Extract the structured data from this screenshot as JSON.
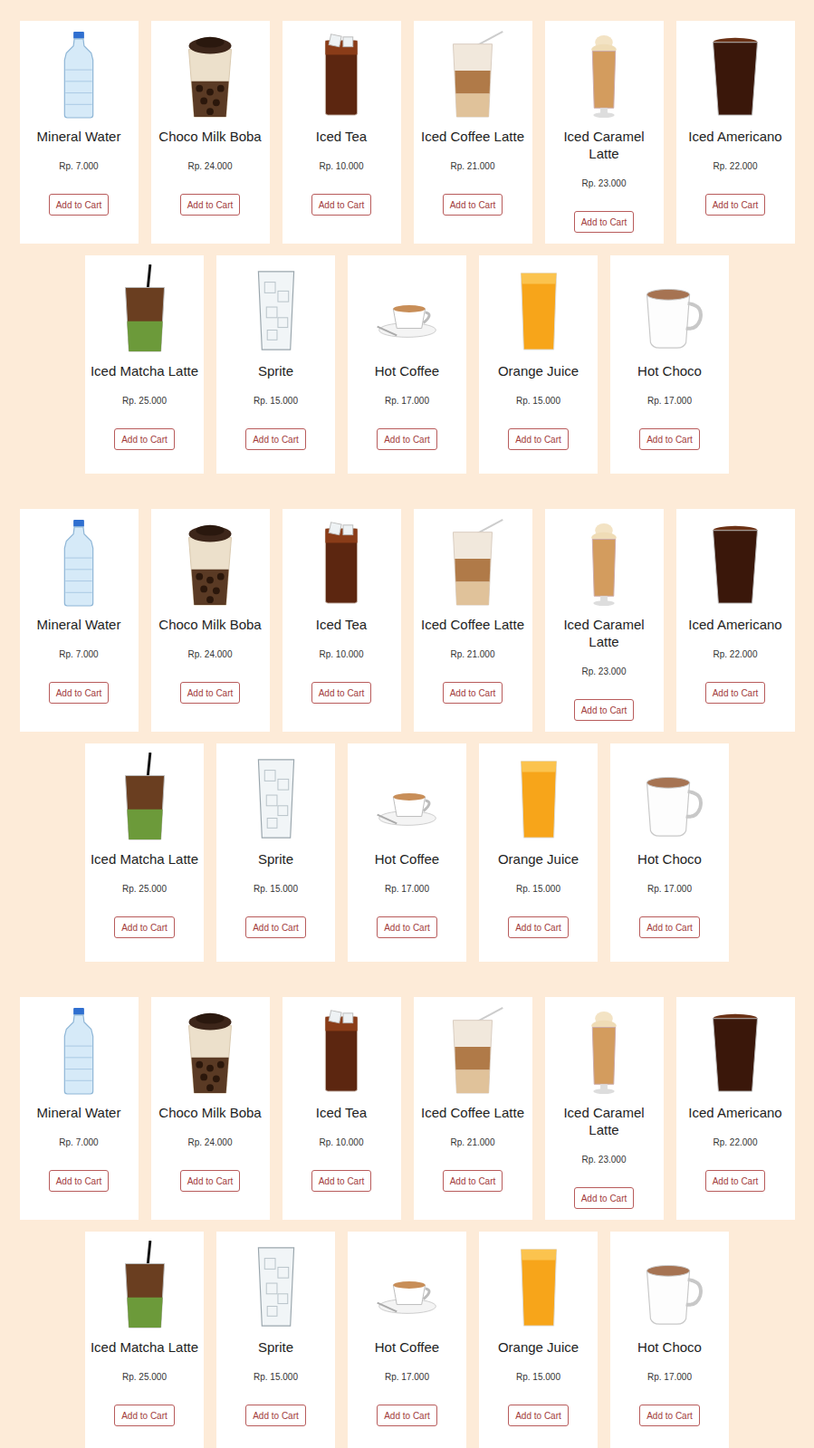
{
  "sections": [
    {
      "items": [
        {
          "name": "Mineral Water",
          "price": "Rp. 7.000",
          "button": "Add to Cart",
          "kind": "bottle"
        },
        {
          "name": "Choco Milk Boba",
          "price": "Rp. 24.000",
          "button": "Add to Cart",
          "kind": "boba"
        },
        {
          "name": "Iced Tea",
          "price": "Rp. 10.000",
          "button": "Add to Cart",
          "kind": "tea"
        },
        {
          "name": "Iced Coffee Latte",
          "price": "Rp. 21.000",
          "button": "Add to Cart",
          "kind": "latte"
        },
        {
          "name": "Iced Caramel Latte",
          "price": "Rp. 23.000",
          "button": "Add to Cart",
          "kind": "caramel"
        },
        {
          "name": "Iced Americano",
          "price": "Rp. 22.000",
          "button": "Add to Cart",
          "kind": "americano"
        },
        {
          "name": "Iced Matcha Latte",
          "price": "Rp. 25.000",
          "button": "Add to Cart",
          "kind": "matcha"
        },
        {
          "name": "Sprite",
          "price": "Rp. 15.000",
          "button": "Add to Cart",
          "kind": "sprite"
        },
        {
          "name": "Hot Coffee",
          "price": "Rp. 17.000",
          "button": "Add to Cart",
          "kind": "coffee"
        },
        {
          "name": "Orange Juice",
          "price": "Rp. 15.000",
          "button": "Add to Cart",
          "kind": "juice"
        },
        {
          "name": "Hot Choco",
          "price": "Rp. 17.000",
          "button": "Add to Cart",
          "kind": "choco"
        }
      ]
    },
    {
      "items": [
        {
          "name": "Mineral Water",
          "price": "Rp. 7.000",
          "button": "Add to Cart",
          "kind": "bottle"
        },
        {
          "name": "Choco Milk Boba",
          "price": "Rp. 24.000",
          "button": "Add to Cart",
          "kind": "boba"
        },
        {
          "name": "Iced Tea",
          "price": "Rp. 10.000",
          "button": "Add to Cart",
          "kind": "tea"
        },
        {
          "name": "Iced Coffee Latte",
          "price": "Rp. 21.000",
          "button": "Add to Cart",
          "kind": "latte"
        },
        {
          "name": "Iced Caramel Latte",
          "price": "Rp. 23.000",
          "button": "Add to Cart",
          "kind": "caramel"
        },
        {
          "name": "Iced Americano",
          "price": "Rp. 22.000",
          "button": "Add to Cart",
          "kind": "americano"
        },
        {
          "name": "Iced Matcha Latte",
          "price": "Rp. 25.000",
          "button": "Add to Cart",
          "kind": "matcha"
        },
        {
          "name": "Sprite",
          "price": "Rp. 15.000",
          "button": "Add to Cart",
          "kind": "sprite"
        },
        {
          "name": "Hot Coffee",
          "price": "Rp. 17.000",
          "button": "Add to Cart",
          "kind": "coffee"
        },
        {
          "name": "Orange Juice",
          "price": "Rp. 15.000",
          "button": "Add to Cart",
          "kind": "juice"
        },
        {
          "name": "Hot Choco",
          "price": "Rp. 17.000",
          "button": "Add to Cart",
          "kind": "choco"
        }
      ]
    },
    {
      "items": [
        {
          "name": "Mineral Water",
          "price": "Rp. 7.000",
          "button": "Add to Cart",
          "kind": "bottle"
        },
        {
          "name": "Choco Milk Boba",
          "price": "Rp. 24.000",
          "button": "Add to Cart",
          "kind": "boba"
        },
        {
          "name": "Iced Tea",
          "price": "Rp. 10.000",
          "button": "Add to Cart",
          "kind": "tea"
        },
        {
          "name": "Iced Coffee Latte",
          "price": "Rp. 21.000",
          "button": "Add to Cart",
          "kind": "latte"
        },
        {
          "name": "Iced Caramel Latte",
          "price": "Rp. 23.000",
          "button": "Add to Cart",
          "kind": "caramel"
        },
        {
          "name": "Iced Americano",
          "price": "Rp. 22.000",
          "button": "Add to Cart",
          "kind": "americano"
        },
        {
          "name": "Iced Matcha Latte",
          "price": "Rp. 25.000",
          "button": "Add to Cart",
          "kind": "matcha"
        },
        {
          "name": "Sprite",
          "price": "Rp. 15.000",
          "button": "Add to Cart",
          "kind": "sprite"
        },
        {
          "name": "Hot Coffee",
          "price": "Rp. 17.000",
          "button": "Add to Cart",
          "kind": "coffee"
        },
        {
          "name": "Orange Juice",
          "price": "Rp. 15.000",
          "button": "Add to Cart",
          "kind": "juice"
        },
        {
          "name": "Hot Choco",
          "price": "Rp. 17.000",
          "button": "Add to Cart",
          "kind": "choco"
        }
      ]
    }
  ]
}
